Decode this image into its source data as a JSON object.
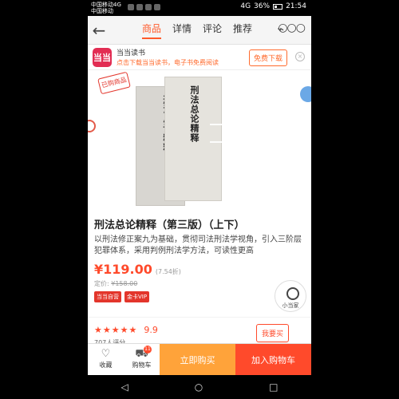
{
  "status": {
    "carrier1": "中国移动4G",
    "carrier2": "中国移动",
    "network": "4G",
    "battery": "36%",
    "time": "21:54"
  },
  "nav": {
    "tabs": [
      {
        "label": "商品",
        "active": true
      },
      {
        "label": "详情",
        "active": false
      },
      {
        "label": "评论",
        "active": false
      },
      {
        "label": "推荐",
        "active": false
      }
    ]
  },
  "promo": {
    "logo": "当当",
    "title": "当当读书",
    "subtitle": "点击下载当当读书，电子书免费阅读",
    "button": "免费下载"
  },
  "image": {
    "owned_badge": "已购商品",
    "book_title_vertical": "刑法总论精释"
  },
  "product": {
    "title": "刑法总论精释（第三版）（上下）",
    "description": "以刑法修正案九为基础，贯彻司法刑法学视角，引入三阶层犯罪体系，采用判例刑法学方法，可读性更高",
    "price": "¥119.00",
    "discount": "(7.54折)",
    "orig_label": "定价:",
    "orig_price": "¥158.00",
    "tags": [
      "当当自营",
      "金卡VIP"
    ],
    "assistant_label": "小当家"
  },
  "rating": {
    "stars": "★★★★★",
    "score": "9.9",
    "reviews": "707人评分",
    "buy_rec": "我要买"
  },
  "actions": {
    "favorite": "收藏",
    "cart": "购物车",
    "cart_count": "11",
    "buy_now": "立即购买",
    "add_to_cart": "加入购物车"
  },
  "colors": {
    "accent": "#ff4a2b",
    "buy_now_bg": "#ffa33a"
  }
}
